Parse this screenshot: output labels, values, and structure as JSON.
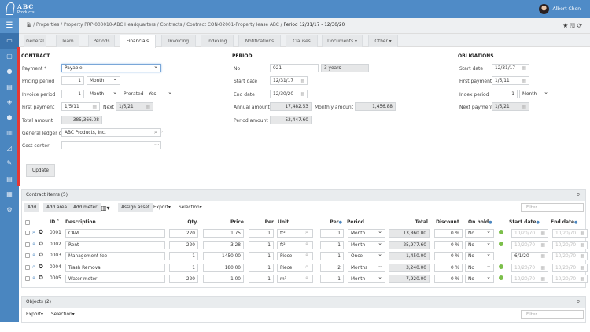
{
  "header": {
    "logo_text": "ABC",
    "logo_sub": "Products",
    "user_name": "Albert Chen"
  },
  "sidebar": {
    "icons": [
      "monitor-icon",
      "square-icon",
      "user-icon",
      "document-icon",
      "tag-icon",
      "cube-icon",
      "building-icon",
      "chart-icon",
      "edit-icon",
      "report-icon",
      "bar-chart-icon",
      "gear-icon"
    ]
  },
  "breadcrumb": {
    "items": [
      "Properties",
      "Property PRP-000010-ABC Headquarters",
      "Contracts",
      "Contract CON-02001-Property lease ABC"
    ],
    "current": "Period 12/31/17 - 12/30/20"
  },
  "tabs": [
    "General",
    "Team",
    "Periods",
    "Financials",
    "Invoicing",
    "Indexing",
    "Notifications",
    "Clauses",
    "Documents ▾",
    "Other ▾"
  ],
  "active_tab": "Financials",
  "contract": {
    "title": "CONTRACT",
    "payment_label": "Payment *",
    "payment": "Payable",
    "pricing_period_label": "Pricing period",
    "pricing_qty": "1",
    "pricing_unit": "Month",
    "invoice_period_label": "Invoice period",
    "invoice_qty": "1",
    "invoice_unit": "Month",
    "prorated_label": "Prorated",
    "prorated": "Yes",
    "first_payment_label": "First payment",
    "first_payment": "1/5/11",
    "next_label": "Next",
    "next": "1/5/21",
    "total_amount_label": "Total amount",
    "total_amount": "385,366.08",
    "gl_label": "General ledger of",
    "gl": "ABC Products, Inc.",
    "cost_center_label": "Cost center",
    "cost_center": "",
    "update_label": "Update"
  },
  "period": {
    "title": "PERIOD",
    "no_label": "No",
    "no": "021",
    "duration": "3 years",
    "start_label": "Start date",
    "start": "12/31/17",
    "end_label": "End date",
    "end": "12/30/20",
    "annual_label": "Annual amount",
    "annual": "17,482.53",
    "monthly_label": "Monthly amount",
    "monthly": "1,456.88",
    "period_amount_label": "Period amount",
    "period_amount": "52,447.60"
  },
  "obligations": {
    "title": "OBLIGATIONS",
    "start_label": "Start date",
    "start": "12/31/17",
    "first_label": "First payment",
    "first": "1/5/11",
    "index_label": "Index period",
    "index_qty": "1",
    "index_unit": "Month",
    "next_label": "Next payment",
    "next": "1/5/21"
  },
  "items": {
    "title": "Contract items (5)",
    "toolbar": {
      "add": "Add",
      "add_area": "Add area",
      "add_meter": "Add meter",
      "assign_asset": "Assign asset",
      "export": "Export",
      "selection": "Selection"
    },
    "filter_placeholder": "Filter",
    "columns": {
      "id": "ID",
      "description": "Description",
      "qty": "Qty.",
      "price": "Price",
      "per": "Per",
      "unit": "Unit",
      "per2": "Per",
      "period": "Period",
      "total": "Total",
      "discount": "Discount",
      "on_hold": "On hold",
      "start_date": "Start date",
      "end_date": "End date"
    },
    "rows": [
      {
        "id": "0001",
        "description": "CAM",
        "qty": "220",
        "price": "1.75",
        "per": "1",
        "unit": "ft²",
        "per2": "1",
        "period": "Month",
        "total": "13,860.00",
        "discount": "0 %",
        "on_hold": "No",
        "active": true,
        "start": "10/20/70",
        "end": "10/20/70"
      },
      {
        "id": "0002",
        "description": "Rent",
        "qty": "220",
        "price": "3.28",
        "per": "1",
        "unit": "ft²",
        "per2": "1",
        "period": "Month",
        "total": "25,977.60",
        "discount": "0 %",
        "on_hold": "No",
        "active": true,
        "start": "10/20/70",
        "end": "10/20/70"
      },
      {
        "id": "0003",
        "description": "Management fee",
        "qty": "1",
        "price": "1450.00",
        "per": "1",
        "unit": "Piece",
        "per2": "1",
        "period": "Once",
        "total": "1,450.00",
        "discount": "0 %",
        "on_hold": "No",
        "active": false,
        "start": "6/1/20",
        "end": "10/20/70"
      },
      {
        "id": "0004",
        "description": "Trash Removal",
        "qty": "1",
        "price": "180.00",
        "per": "1",
        "unit": "Piece",
        "per2": "2",
        "period": "Months",
        "total": "3,240.00",
        "discount": "0 %",
        "on_hold": "No",
        "active": true,
        "start": "10/20/70",
        "end": "10/20/70"
      },
      {
        "id": "0005",
        "description": "Water meter",
        "qty": "220",
        "price": "1.00",
        "per": "1",
        "unit": "m³",
        "per2": "1",
        "period": "Month",
        "total": "7,920.00",
        "discount": "0 %",
        "on_hold": "No",
        "active": true,
        "start": "10/20/70",
        "end": "10/20/70"
      }
    ]
  },
  "objects": {
    "title": "Objects (2)",
    "export": "Export",
    "selection": "Selection",
    "filter_placeholder": "Filter"
  },
  "colors": {
    "header": "#4f8bc7",
    "sidebar": "#4a86c0",
    "accent_bar": "#e53935",
    "status_active": "#7cbf4a"
  }
}
